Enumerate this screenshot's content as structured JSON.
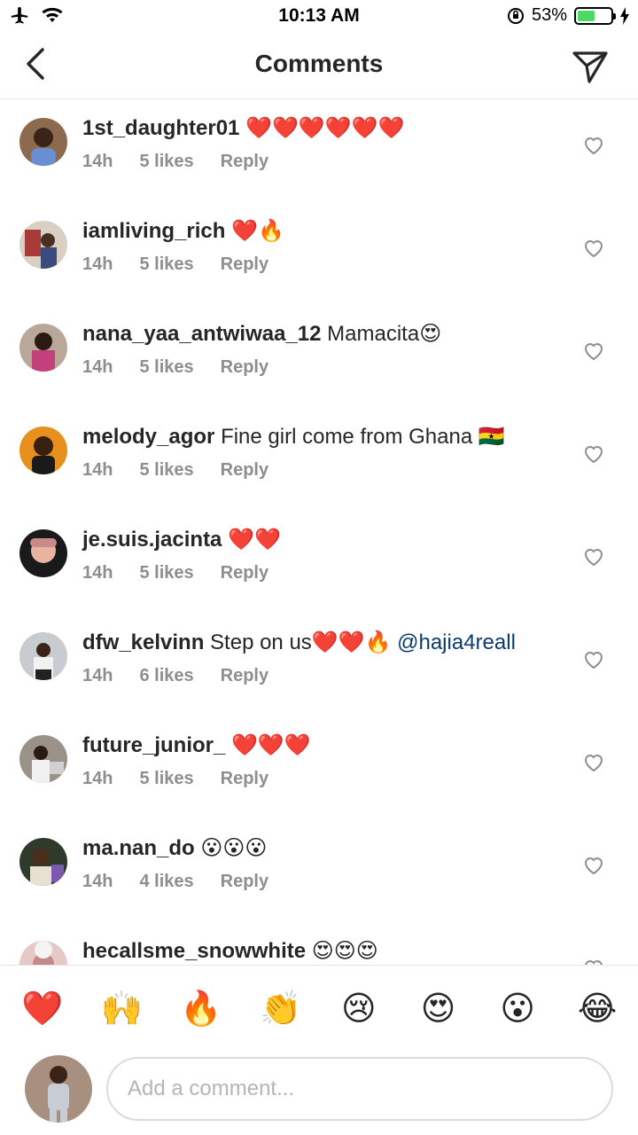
{
  "status": {
    "time": "10:13 AM",
    "battery": "53%",
    "battery_level": 0.53,
    "battery_color": "#4cd964"
  },
  "header": {
    "title": "Comments",
    "back_icon": "chevron-left-icon",
    "send_icon": "paper-plane-icon"
  },
  "comments": [
    {
      "username": "1st_daughter01",
      "text": "❤️❤️❤️❤️❤️❤️",
      "time": "14h",
      "likes": "5 likes",
      "reply": "Reply"
    },
    {
      "username": "iamliving_rich",
      "text": "❤️🔥",
      "time": "14h",
      "likes": "5 likes",
      "reply": "Reply"
    },
    {
      "username": "nana_yaa_antwiwaa_12",
      "text": "Mamacita😍",
      "time": "14h",
      "likes": "5 likes",
      "reply": "Reply"
    },
    {
      "username": "melody_agor",
      "text": "Fine girl come from Ghana 🇬🇭",
      "time": "14h",
      "likes": "5 likes",
      "reply": "Reply"
    },
    {
      "username": "je.suis.jacinta",
      "text": "❤️❤️",
      "time": "14h",
      "likes": "5 likes",
      "reply": "Reply"
    },
    {
      "username": "dfw_kelvinn",
      "text": "Step on us❤️❤️🔥",
      "mention": "@hajia4reall",
      "time": "14h",
      "likes": "6 likes",
      "reply": "Reply"
    },
    {
      "username": "future_junior_",
      "text": "❤️❤️❤️",
      "time": "14h",
      "likes": "5 likes",
      "reply": "Reply"
    },
    {
      "username": "ma.nan_do",
      "text": "😮😮😮",
      "time": "14h",
      "likes": "4 likes",
      "reply": "Reply"
    },
    {
      "username": "hecallsme_snowwhite",
      "text": "😍😍😍",
      "time": "",
      "likes": "",
      "reply": ""
    }
  ],
  "reactions": [
    "❤️",
    "🙌",
    "🔥",
    "👏",
    "😢",
    "😍",
    "😮",
    "😂"
  ],
  "composer": {
    "placeholder": "Add a comment..."
  },
  "colors": {
    "text": "#262626",
    "meta": "#8e8e8e",
    "mention": "#0a3a6e",
    "divider": "#e6e6e6"
  }
}
